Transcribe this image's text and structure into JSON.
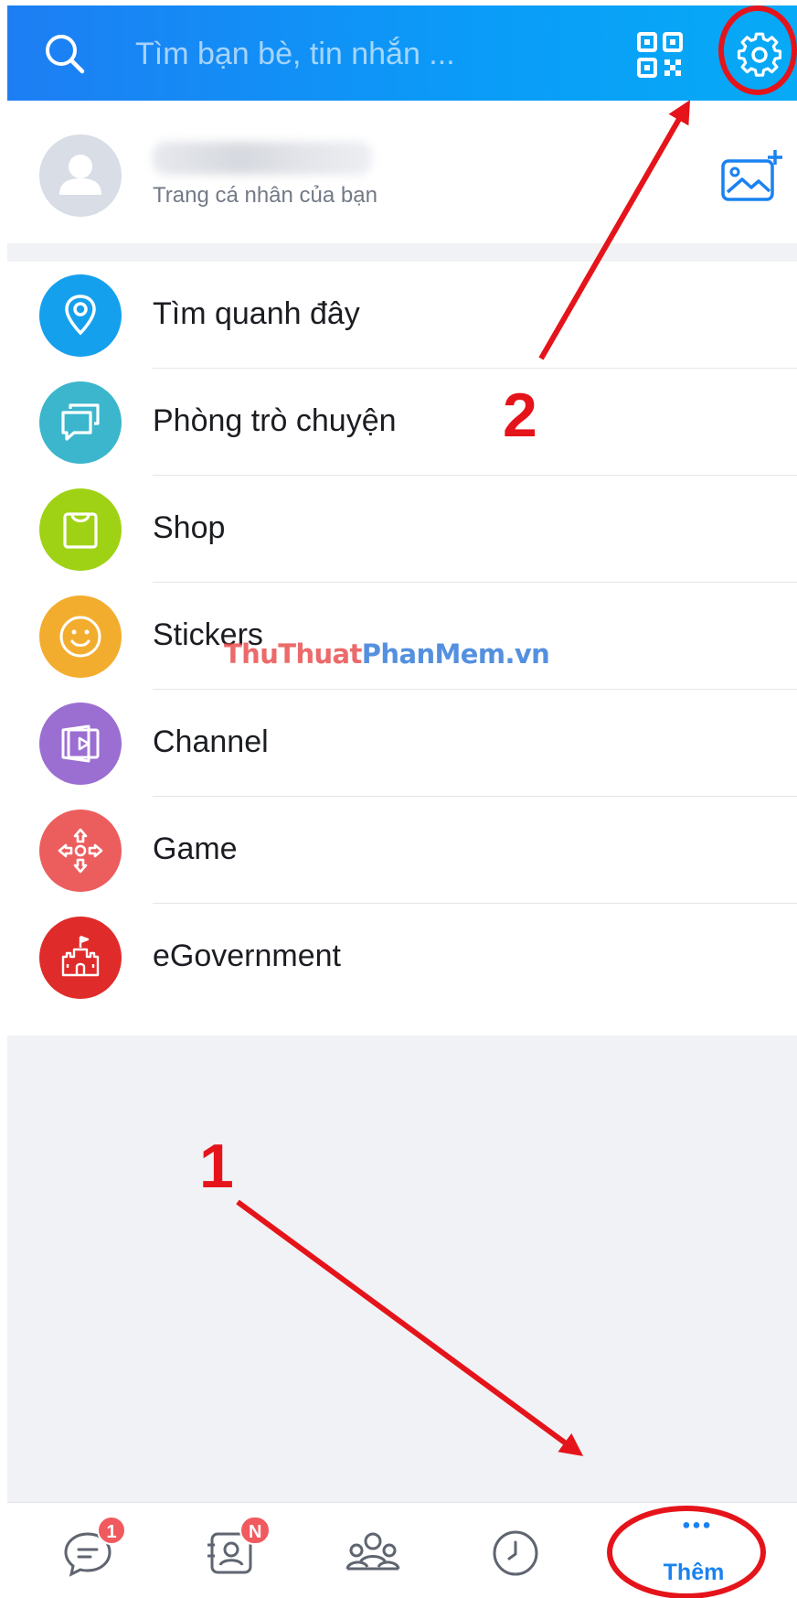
{
  "header": {
    "search_placeholder": "Tìm bạn bè, tin nhắn ...",
    "accent_color": "#0a9cf8"
  },
  "profile": {
    "subtitle": "Trang cá nhân của bạn"
  },
  "menu": {
    "items": [
      {
        "label": "Tìm quanh đây",
        "icon": "location-pin-icon",
        "color": "#15a0ee"
      },
      {
        "label": "Phòng trò chuyện",
        "icon": "chat-rooms-icon",
        "color": "#3bb6cc"
      },
      {
        "label": "Shop",
        "icon": "shopping-bag-icon",
        "color": "#9fd214"
      },
      {
        "label": "Stickers",
        "icon": "smiley-icon",
        "color": "#f3ad2e"
      },
      {
        "label": "Channel",
        "icon": "video-play-icon",
        "color": "#9b6ed2"
      },
      {
        "label": "Game",
        "icon": "game-controller-icon",
        "color": "#ec5e5e"
      },
      {
        "label": "eGovernment",
        "icon": "government-building-icon",
        "color": "#e02b2b"
      }
    ]
  },
  "watermark": {
    "part1": "ThuThuat",
    "part2": "PhanMem",
    "part3": ".vn"
  },
  "tabbar": {
    "messages_badge": "1",
    "contacts_badge": "N",
    "more_label": "Thêm",
    "active_color": "#1a82f0"
  },
  "annotations": {
    "step1": "1",
    "step2": "2",
    "color": "#e5141a"
  }
}
